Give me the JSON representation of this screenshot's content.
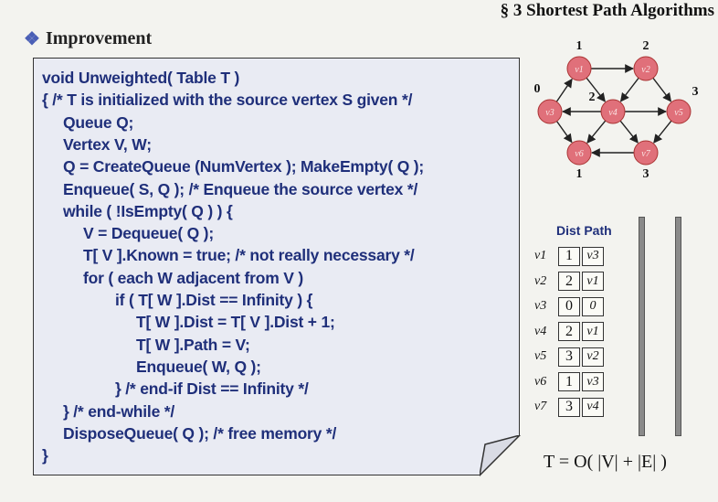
{
  "header": {
    "title": "§ 3  Shortest Path Algorithms"
  },
  "section": {
    "title": "Improvement"
  },
  "code": [
    {
      "t": "void Unweighted( Table T )",
      "indent": 0,
      "kind": "plain"
    },
    {
      "t": "{  /* T is initialized with the source vertex S given */",
      "indent": 0,
      "kind": "mixed1"
    },
    {
      "t": "Queue  Q;",
      "indent": 1,
      "kind": "plain"
    },
    {
      "t": "Vertex  V, W;",
      "indent": 1,
      "kind": "plain"
    },
    {
      "t": "Q = CreateQueue (NumVertex );  MakeEmpty( Q );",
      "indent": 1,
      "kind": "plain"
    },
    {
      "t": "Enqueue( S, Q ); /* Enqueue the source vertex */",
      "indent": 1,
      "kind": "plain"
    },
    {
      "t": "while ( !IsEmpty( Q ) ) {",
      "indent": 1,
      "kind": "plain"
    },
    {
      "t": "V = Dequeue( Q );",
      "indent": 2,
      "kind": "plain"
    },
    {
      "t": "T[ V ].Known = true; /* not really necessary */",
      "indent": 2,
      "kind": "plain"
    },
    {
      "t": "for ( each W adjacent from V )",
      "indent": 2,
      "kind": "plain"
    },
    {
      "t": "if ( T[ W ].Dist == Infinity ) {",
      "indent": 3,
      "kind": "plain"
    },
    {
      "t": "T[ W ].Dist = T[ V ].Dist + 1;",
      "indent": 4,
      "kind": "plain"
    },
    {
      "t": "T[ W ].Path = V;",
      "indent": 4,
      "kind": "plain"
    },
    {
      "t": "Enqueue( W, Q );",
      "indent": 4,
      "kind": "plain"
    },
    {
      "t": "} /* end-if Dist == Infinity */",
      "indent": 3,
      "kind": "plain"
    },
    {
      "t": "} /* end-while */",
      "indent": 1,
      "kind": "plain"
    },
    {
      "t": "DisposeQueue( Q ); /* free memory */",
      "indent": 1,
      "kind": "plain"
    },
    {
      "t": "}",
      "indent": 0,
      "kind": "plain"
    }
  ],
  "graph": {
    "nodes": [
      {
        "id": "v1",
        "label": "v1",
        "dist": "1"
      },
      {
        "id": "v2",
        "label": "v2",
        "dist": "2"
      },
      {
        "id": "v3",
        "label": "v3",
        "dist": "0"
      },
      {
        "id": "v4",
        "label": "v4",
        "dist": "2"
      },
      {
        "id": "v5",
        "label": "v5",
        "dist": "3"
      },
      {
        "id": "v6",
        "label": "v6",
        "dist": "1"
      },
      {
        "id": "v7",
        "label": "v7",
        "dist": "3"
      }
    ],
    "node_color": "#e0707a",
    "edges": [
      [
        "v1",
        "v2"
      ],
      [
        "v1",
        "v4"
      ],
      [
        "v2",
        "v4"
      ],
      [
        "v2",
        "v5"
      ],
      [
        "v3",
        "v1"
      ],
      [
        "v3",
        "v6"
      ],
      [
        "v4",
        "v3"
      ],
      [
        "v4",
        "v5"
      ],
      [
        "v4",
        "v6"
      ],
      [
        "v4",
        "v7"
      ],
      [
        "v5",
        "v7"
      ],
      [
        "v7",
        "v6"
      ]
    ]
  },
  "table": {
    "title": "Dist Path",
    "rows": [
      {
        "v": "v1",
        "dist": "1",
        "path": "v3"
      },
      {
        "v": "v2",
        "dist": "2",
        "path": "v1"
      },
      {
        "v": "v3",
        "dist": "0",
        "path": "0"
      },
      {
        "v": "v4",
        "dist": "2",
        "path": "v1"
      },
      {
        "v": "v5",
        "dist": "3",
        "path": "v2"
      },
      {
        "v": "v6",
        "dist": "1",
        "path": "v3"
      },
      {
        "v": "v7",
        "dist": "3",
        "path": "v4"
      }
    ]
  },
  "complexity": "T = O( |V| + |E| )"
}
